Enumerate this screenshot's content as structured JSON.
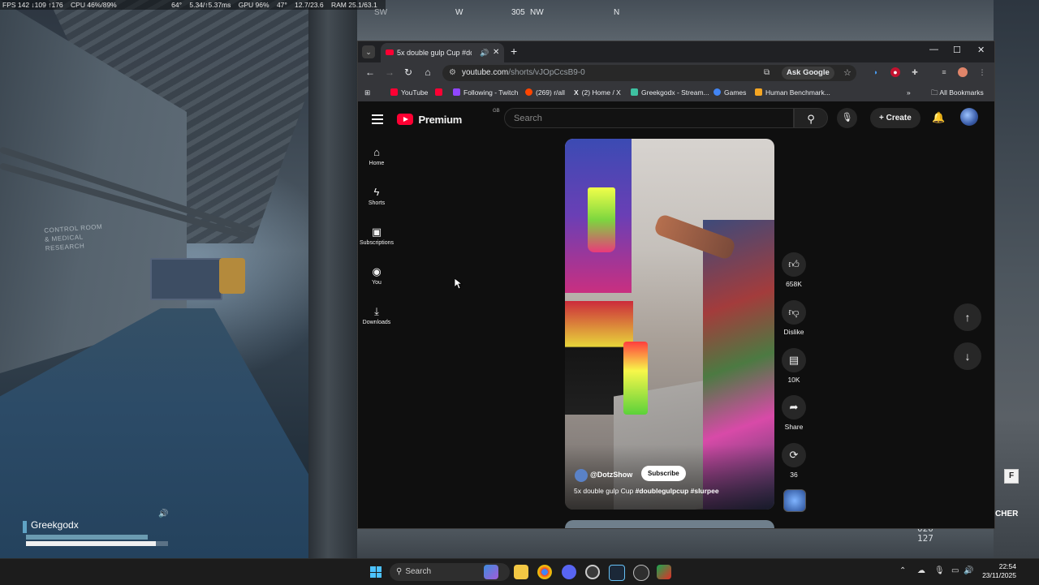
{
  "perf_overlay": {
    "fps": "FPS 142 ↓109 ↑176",
    "cpu": "CPU 46%/89%",
    "cpu_temp": "64°",
    "frametime": "5.34/↑5.37ms",
    "gpu": "GPU 96%",
    "gpu_temp": "47°",
    "vram": "12.7/23.6",
    "ram": "RAM 25.1/63.1"
  },
  "compass": {
    "sw": "SW",
    "w": "W",
    "heading": "305",
    "nw": "NW",
    "n": "N"
  },
  "game_hud": {
    "player_name": "Greekgodx",
    "right_label": "CHER",
    "ammo_top": "020",
    "ammo_bottom": "127",
    "key_hint": "F",
    "wall_sign": "CONTROL ROOM & MEDICAL RESEARCH"
  },
  "browser": {
    "tab_title": "5x double gulp Cup #doubl",
    "new_tab": "+",
    "url_host": "youtube.com",
    "url_path": "/shorts/vJOpCcsB9-0",
    "ask_google": "Ask Google",
    "bookmarks": [
      {
        "label": "YouTube",
        "color": "#ff0033"
      },
      {
        "label": "",
        "color": "#ff0033"
      },
      {
        "label": "Following - Twitch",
        "color": "#9146ff"
      },
      {
        "label": "(269) r/all",
        "color": "#ff4500"
      },
      {
        "label": "(2) Home / X",
        "color": "#000000"
      },
      {
        "label": "Greekgodx - Stream...",
        "color": "#3ec1a1"
      },
      {
        "label": "Games",
        "color": "#4285f4"
      },
      {
        "label": "Human Benchmark...",
        "color": "#f5a623"
      }
    ],
    "all_bookmarks": "All Bookmarks"
  },
  "youtube": {
    "logo_text": "Premium",
    "logo_region": "GB",
    "search_placeholder": "Search",
    "create_label": "Create",
    "sidebar": [
      {
        "label": "Home",
        "icon": "home-icon"
      },
      {
        "label": "Shorts",
        "icon": "shorts-icon"
      },
      {
        "label": "Subscriptions",
        "icon": "subscriptions-icon"
      },
      {
        "label": "You",
        "icon": "you-icon"
      },
      {
        "label": "Downloads",
        "icon": "downloads-icon"
      }
    ],
    "short": {
      "channel": "@DotzShow",
      "subscribe": "Subscribe",
      "title_plain": "5x double gulp Cup ",
      "title_tags": "#doublegulpcup #slurpee"
    },
    "actions": {
      "likes": "658K",
      "dislike": "Dislike",
      "comments": "10K",
      "share": "Share",
      "remix": "36"
    }
  },
  "taskbar": {
    "search_label": "Search",
    "time": "22:54",
    "date": "23/11/2025",
    "accent": "#4cc2ff"
  }
}
